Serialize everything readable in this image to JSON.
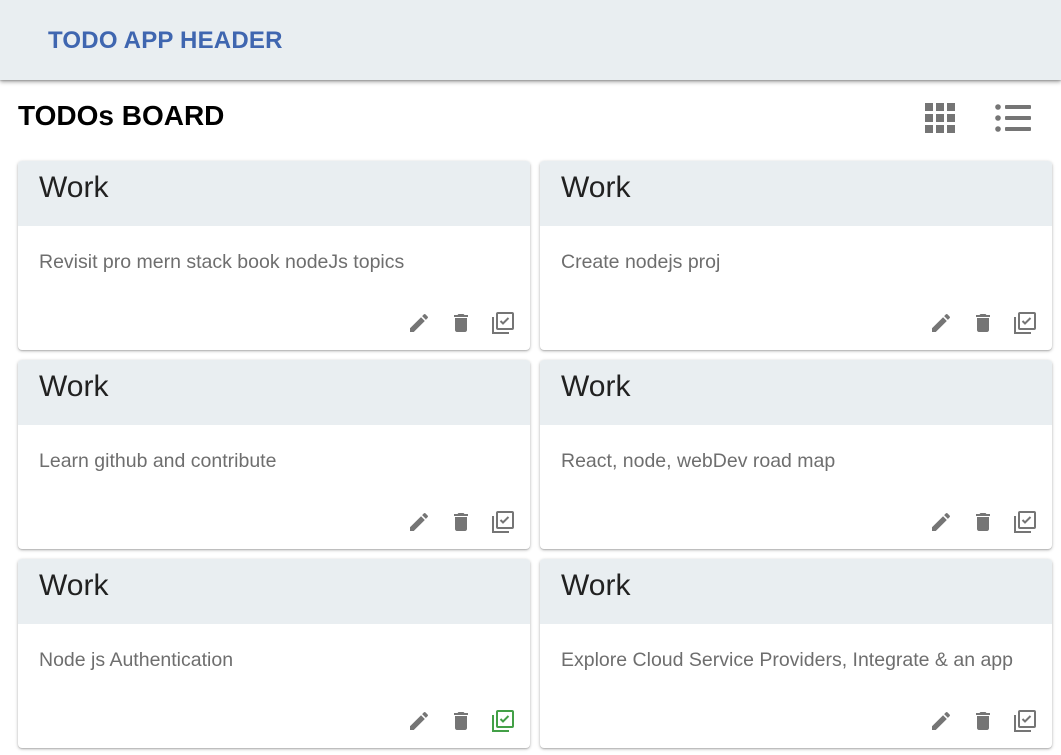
{
  "header": {
    "title": "TODO APP HEADER"
  },
  "board": {
    "title": "TODOs BOARD",
    "view_icons": {
      "grid": "grid-view-icon",
      "list": "list-view-icon"
    }
  },
  "colors": {
    "header_bg": "#e9eef1",
    "header_title": "#3f66b0",
    "card_head_bg": "#e9eef1",
    "icon_gray": "#757575",
    "done_green": "#43a047"
  },
  "todos": [
    {
      "category": "Work",
      "text": "Revisit pro mern stack book nodeJs topics",
      "done": false
    },
    {
      "category": "Work",
      "text": "Create nodejs proj",
      "done": false
    },
    {
      "category": "Work",
      "text": "Learn github and contribute",
      "done": false
    },
    {
      "category": "Work",
      "text": "React, node, webDev road map",
      "done": false
    },
    {
      "category": "Work",
      "text": "Node js Authentication",
      "done": true
    },
    {
      "category": "Work",
      "text": "Explore Cloud Service Providers, Integrate & an app",
      "done": false
    }
  ],
  "card_actions": [
    "edit-icon",
    "delete-icon",
    "complete-icon"
  ]
}
